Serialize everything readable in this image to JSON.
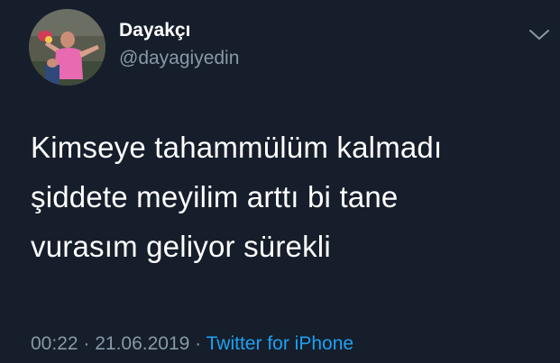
{
  "tweet": {
    "author": {
      "display_name": "Dayakçı",
      "handle": "@dayagiyedin"
    },
    "text": "Kimseye tahammülüm kalmadı\nşiddete meyilim arttı bi tane\nvurasım geliyor sürekli",
    "time": "00:22",
    "separator": " · ",
    "date": "21.06.2019",
    "source": "Twitter for iPhone"
  },
  "colors": {
    "background": "#161e2b",
    "primary_text": "#ffffff",
    "secondary_text": "#8899a6",
    "link": "#1da1f2"
  },
  "icons": {
    "menu": "chevron-down-icon",
    "avatar": "avatar"
  }
}
